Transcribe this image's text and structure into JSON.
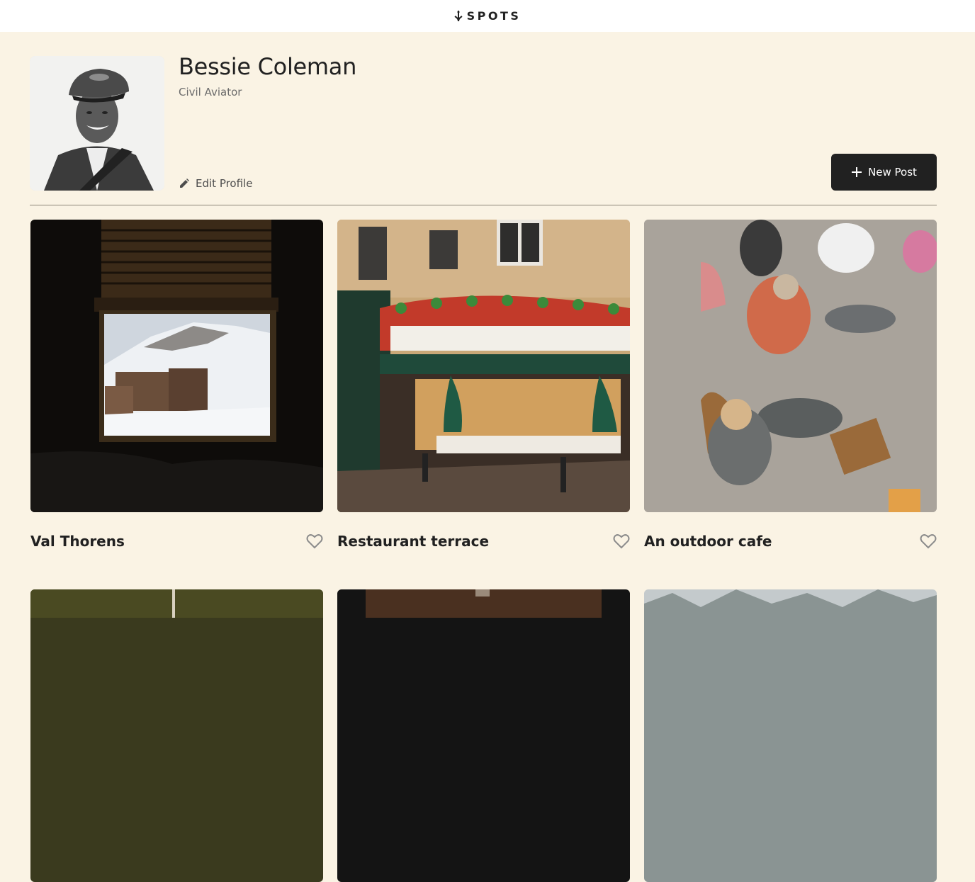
{
  "header": {
    "logo_text": "SPOTS",
    "logo_icon": "spots-logo-icon"
  },
  "profile": {
    "name": "Bessie Coleman",
    "description": "Civil Aviator",
    "edit_label": "Edit Profile",
    "edit_icon": "pencil-icon",
    "new_post_label": "New Post",
    "new_post_icon": "plus-icon"
  },
  "cards": [
    {
      "title": "Val Thorens",
      "like_icon": "heart-icon"
    },
    {
      "title": "Restaurant terrace",
      "like_icon": "heart-icon"
    },
    {
      "title": "An outdoor cafe",
      "like_icon": "heart-icon"
    },
    {
      "title": "",
      "like_icon": "heart-icon"
    },
    {
      "title": "",
      "like_icon": "heart-icon"
    },
    {
      "title": "",
      "like_icon": "heart-icon"
    }
  ],
  "colors": {
    "background": "#FAF3E4",
    "header": "#FFFFFF",
    "text": "#212121",
    "button": "#212121",
    "secondary_text": "#6b6b6b"
  }
}
